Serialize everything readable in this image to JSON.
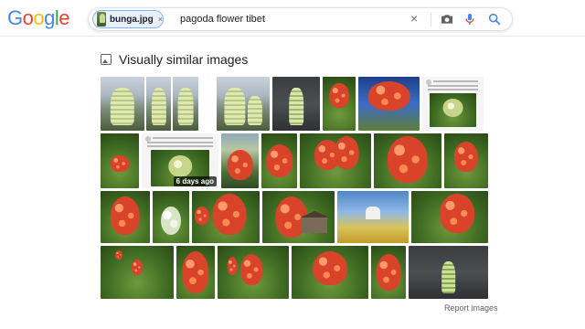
{
  "logo": {
    "letters": [
      "G",
      "o",
      "o",
      "g",
      "l",
      "e"
    ],
    "colors": [
      "#4285f4",
      "#ea4335",
      "#fbbc05",
      "#4285f4",
      "#34a853",
      "#ea4335"
    ]
  },
  "search": {
    "chip_label": "bunga.jpg",
    "chip_close": "×",
    "query": "pagoda flower tibet",
    "clear": "×",
    "accent_color": "#4285f4"
  },
  "section": {
    "title": "Visually similar images"
  },
  "grid": {
    "badge_text": "6 days ago",
    "watermark_1": "",
    "watermark_2": ""
  },
  "footer": {
    "report_label": "Report images"
  }
}
